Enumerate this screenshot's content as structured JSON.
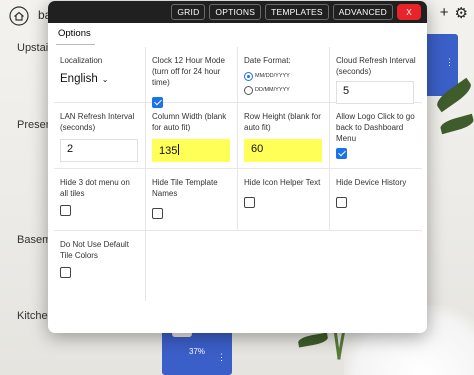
{
  "dashboard": {
    "title": "ba",
    "header_icons": [
      "plus-icon",
      "gear-icon"
    ],
    "rooms": [
      "Upstairs",
      "Presence",
      "Basemen",
      "Kitchen"
    ],
    "tile_percent": "37%"
  },
  "modal": {
    "top_buttons": {
      "grid": "GRID",
      "options": "OPTIONS",
      "templates": "TEMPLATES",
      "advanced": "ADVANCED",
      "close": "X"
    },
    "tab": "Options",
    "settings": {
      "localization": {
        "label": "Localization",
        "value": "English"
      },
      "clock12": {
        "label": "Clock 12 Hour Mode (turn off for 24 hour time)",
        "checked": true
      },
      "date_format": {
        "label": "Date Format:",
        "options": [
          "MM/DD/YYYY",
          "DD/MM/YYYY"
        ],
        "selected": "MM/DD/YYYY"
      },
      "cloud_refresh": {
        "label": "Cloud Refresh Interval (seconds)",
        "value": "5"
      },
      "lan_refresh": {
        "label": "LAN Refresh Interval (seconds)",
        "value": "2"
      },
      "column_width": {
        "label": "Column Width (blank for auto fit)",
        "value": "135"
      },
      "row_height": {
        "label": "Row Height (blank for auto fit)",
        "value": "60"
      },
      "logo_click": {
        "label": "Allow Logo Click to go back to Dashboard Menu",
        "checked": true
      },
      "hide_dots": {
        "label": "Hide 3 dot menu on all tiles",
        "checked": false
      },
      "hide_template_names": {
        "label": "Hide Tile Template Names",
        "checked": false
      },
      "hide_icon_helper": {
        "label": "Hide Icon Helper Text",
        "checked": false
      },
      "hide_device_history": {
        "label": "Hide Device History",
        "checked": false
      },
      "no_default_colors": {
        "label": "Do Not Use Default Tile Colors",
        "checked": false
      }
    }
  },
  "colors": {
    "accent": "#1a73e8",
    "highlight": "#ffff57",
    "close": "#e8232a",
    "toolbar": "#202020",
    "tile": "#3b5fc8"
  }
}
